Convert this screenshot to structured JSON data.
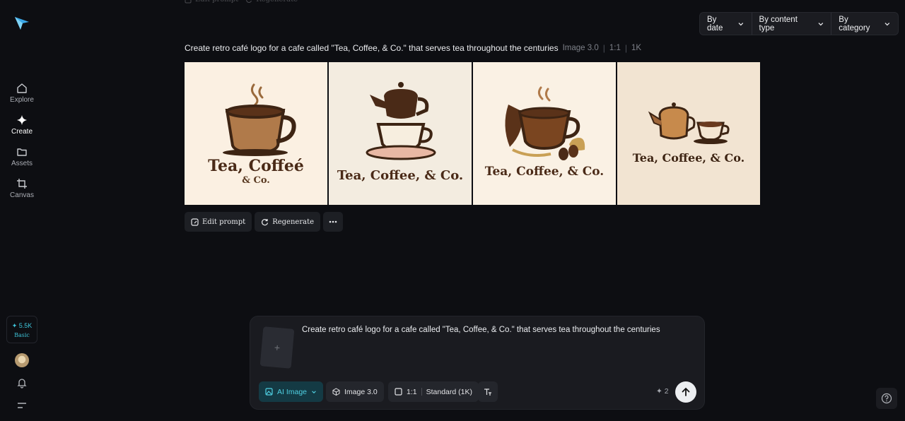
{
  "nav": {
    "items": [
      {
        "label": "Explore"
      },
      {
        "label": "Create"
      },
      {
        "label": "Assets"
      },
      {
        "label": "Canvas"
      }
    ],
    "credits": {
      "amount": "5.5K",
      "plan": "Basic"
    }
  },
  "filters": {
    "by_date": "By date",
    "by_content_type": "By content type",
    "by_category": "By category"
  },
  "result": {
    "prompt": "Create retro café logo for a cafe called \"Tea, Coffee, & Co.\" that serves tea throughout the centuries",
    "model": "Image 3.0",
    "ratio": "1:1",
    "resolution": "1K",
    "images": [
      {
        "line1": "Tea, Coffeé",
        "line2": "& Co.",
        "bg": "#fbf0e2"
      },
      {
        "line1": "Tea, Coffee, & Co.",
        "line2": "",
        "bg": "#f3ece0"
      },
      {
        "line1": "Tea, Coffee, & Co.",
        "line2": "",
        "bg": "#faf1e4"
      },
      {
        "line1": "Tea, Coffee, & Co.",
        "line2": "",
        "bg": "#f2e4d2"
      }
    ]
  },
  "actions": {
    "edit_prompt": "Edit prompt",
    "regenerate": "Regenerate"
  },
  "composer": {
    "text": "Create retro café logo for a cafe called \"Tea, Coffee, & Co.\" that serves tea throughout the centuries",
    "mode": "AI Image",
    "model": "Image 3.0",
    "ratio": "1:1",
    "quality": "Standard (1K)",
    "cost": "2"
  },
  "colors": {
    "accent": "#3ec3d8",
    "background": "#0d0e12",
    "panel": "#1a1b20"
  }
}
